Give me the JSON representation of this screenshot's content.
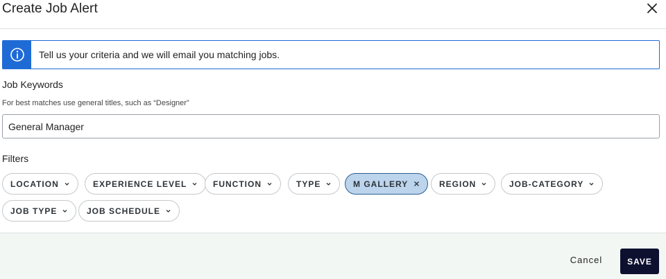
{
  "dialog": {
    "title": "Create Job Alert"
  },
  "info": {
    "message": "Tell us your criteria and we will email you matching jobs.",
    "icon": "info-icon",
    "accent": "#1f6bd6"
  },
  "keywords": {
    "label": "Job Keywords",
    "hint": "For best matches use general titles, such as “Designer”",
    "value": "General Manager"
  },
  "filters": {
    "label": "Filters",
    "chips": [
      {
        "label": "LOCATION",
        "selected": false
      },
      {
        "label": "EXPERIENCE LEVEL",
        "selected": false
      },
      {
        "label": "FUNCTION",
        "selected": false
      },
      {
        "label": "TYPE",
        "selected": false
      },
      {
        "label": "M GALLERY",
        "selected": true
      },
      {
        "label": "REGION",
        "selected": false
      },
      {
        "label": "JOB-CATEGORY",
        "selected": false
      },
      {
        "label": "JOB TYPE",
        "selected": false
      },
      {
        "label": "JOB SCHEDULE",
        "selected": false
      }
    ]
  },
  "footer": {
    "cancel_label": "Cancel",
    "save_label": "SAVE",
    "save_color": "#0e1030"
  }
}
